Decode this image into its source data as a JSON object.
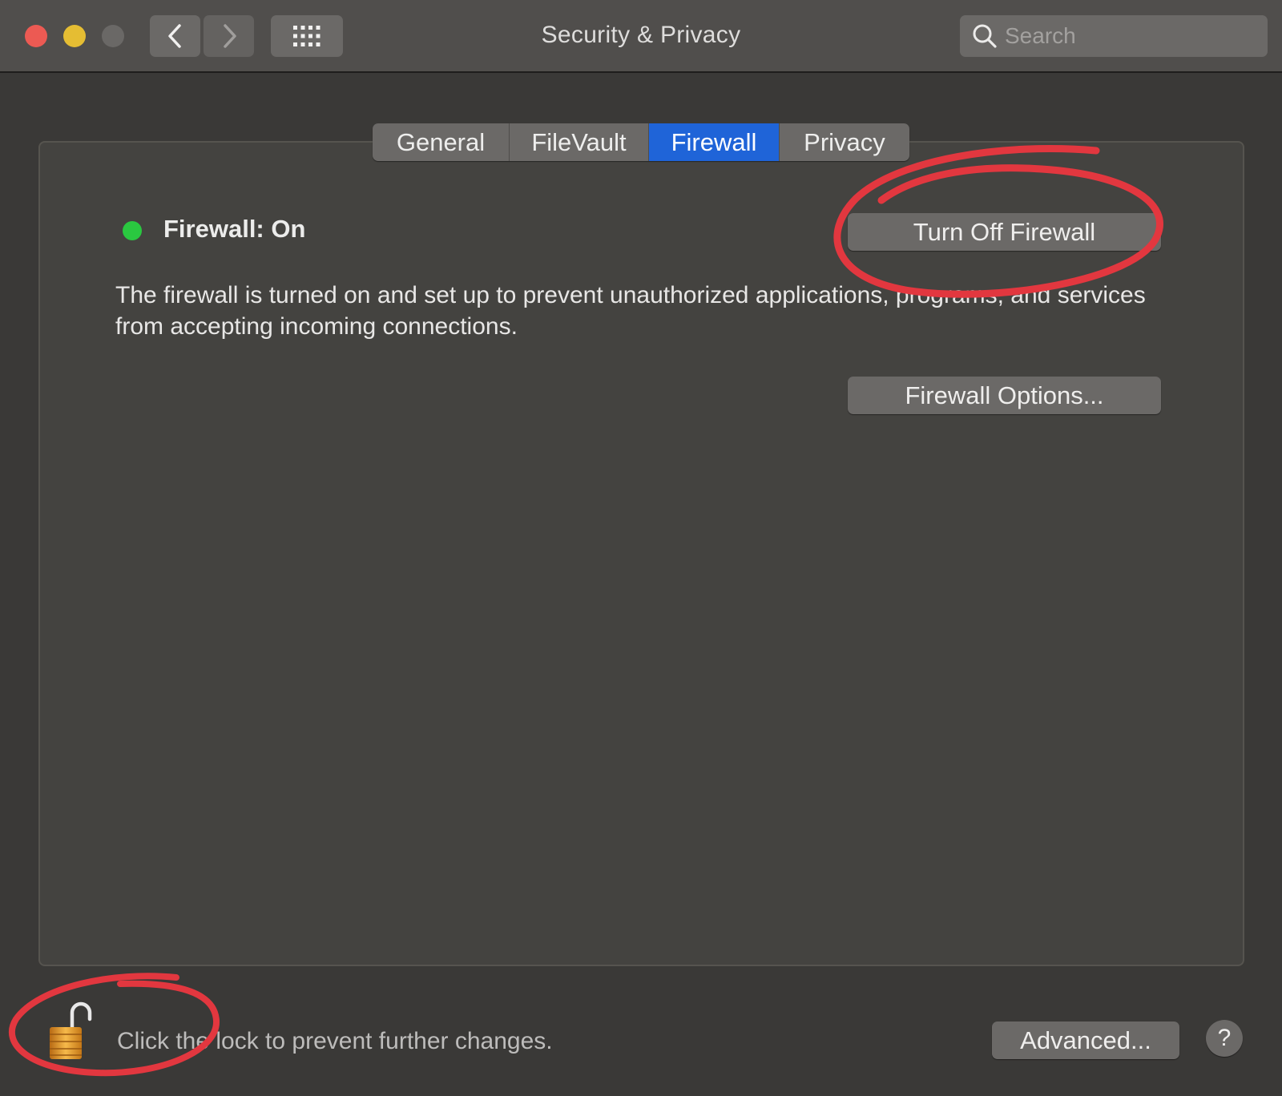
{
  "window": {
    "title": "Security & Privacy"
  },
  "toolbar": {
    "search_placeholder": "Search"
  },
  "tabs": [
    {
      "label": "General",
      "selected": false
    },
    {
      "label": "FileVault",
      "selected": false
    },
    {
      "label": "Firewall",
      "selected": true
    },
    {
      "label": "Privacy",
      "selected": false
    }
  ],
  "firewall": {
    "status": "Firewall: On",
    "status_color": "#2ac840",
    "turn_off_label": "Turn Off Firewall",
    "description": "The firewall is turned on and set up to prevent unauthorized applications, programs, and services from accepting incoming connections.",
    "options_label": "Firewall Options..."
  },
  "footer": {
    "lock_text": "Click the lock to prevent further changes.",
    "lock_icon": "unlocked-padlock-icon",
    "advanced_label": "Advanced...",
    "help_label": "?"
  },
  "colors": {
    "accent": "#1f64d8",
    "annotation": "#e2373f"
  }
}
